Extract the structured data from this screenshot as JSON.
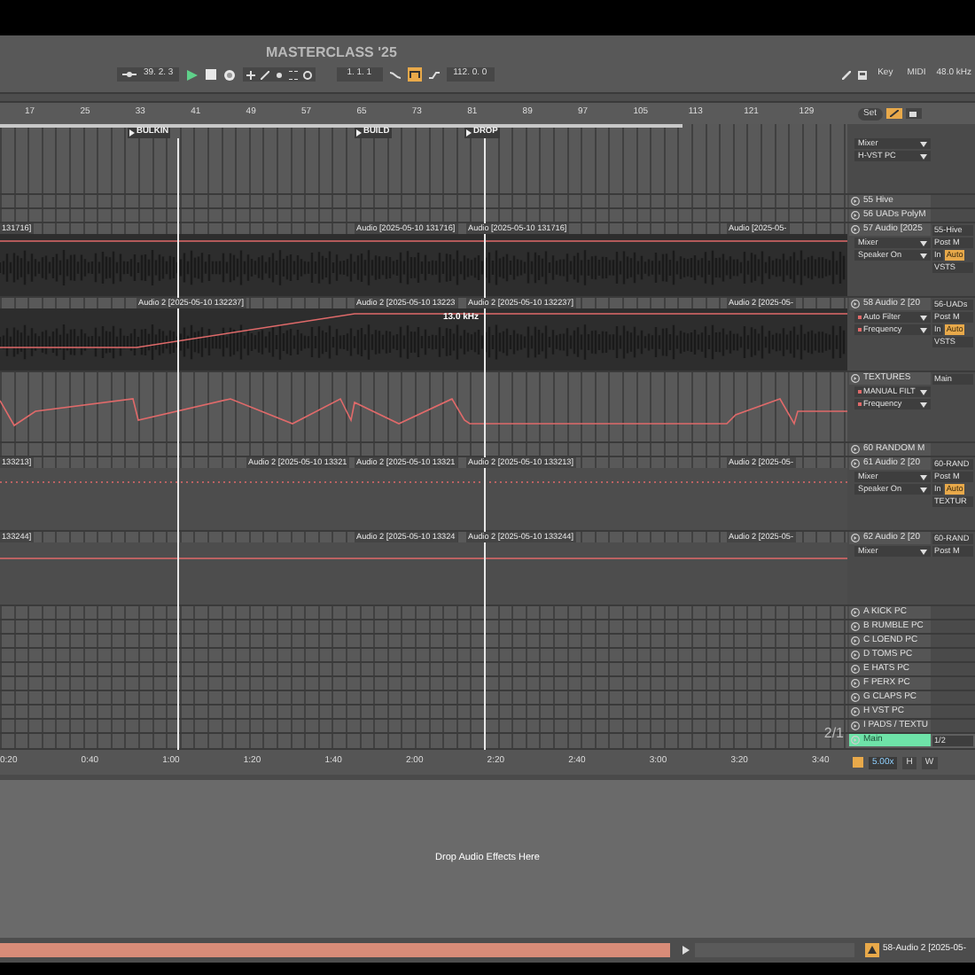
{
  "title": "MASTERCLASS '25",
  "transport": {
    "position": "39. 2. 3",
    "playing": true,
    "loop_start": "1. 1. 1",
    "loop_on": true,
    "loop_length": "112. 0. 0",
    "key_label": "Key",
    "midi_label": "MIDI",
    "sample_rate": "48.0 kHz"
  },
  "bar_ruler": [
    "17",
    "25",
    "33",
    "41",
    "49",
    "57",
    "65",
    "73",
    "81",
    "89",
    "97",
    "105",
    "113",
    "121",
    "129"
  ],
  "locators": [
    "BULKIN",
    "BUILD",
    "DROP"
  ],
  "set_button": "Set",
  "tracks": [
    {
      "kind": "device_rows",
      "devices": [
        {
          "label": "Mixer",
          "automated": false
        },
        {
          "label": "H-VST PC",
          "automated": false
        }
      ]
    },
    {
      "kind": "collapsed",
      "name": "55 Hive"
    },
    {
      "kind": "collapsed",
      "name": "56 UADs PolyM"
    },
    {
      "kind": "audio",
      "name": "57 Audio [2025",
      "devices": [
        {
          "label": "Mixer",
          "automated": false
        },
        {
          "label": "Speaker On",
          "automated": false
        }
      ],
      "io": [
        "55-Hive",
        "Post M"
      ],
      "monitor": [
        {
          "label": "In",
          "selected": false
        },
        {
          "label": "Auto",
          "selected": true
        }
      ],
      "output": "VSTS",
      "lane": {
        "kind": "waveform"
      },
      "clips": [
        "131716]",
        "Audio [2025-05-10 131716]",
        "Audio [2025-05-10 131716]",
        "Audio [2025-05-"
      ]
    },
    {
      "kind": "audio",
      "name": "58 Audio 2 [20",
      "devices": [
        {
          "label": "Auto Filter",
          "automated": true
        },
        {
          "label": "Frequency",
          "automated": true
        }
      ],
      "io": [
        "56-UADs",
        "Post M"
      ],
      "monitor": [
        {
          "label": "In",
          "selected": false
        },
        {
          "label": "Auto",
          "selected": true
        }
      ],
      "output": "VSTS",
      "lane": {
        "kind": "ramp"
      },
      "clips": [
        "Audio 2 [2025-05-10 132237]",
        "Audio 2 [2025-05-10 13223",
        "Audio 2 [2025-05-10 132237]",
        "Audio 2 [2025-05-"
      ],
      "lane_value": "13.0 kHz"
    },
    {
      "kind": "group",
      "name": "TEXTURES",
      "devices": [
        {
          "label": "MANUAL FILT",
          "automated": true
        },
        {
          "label": "Frequency",
          "automated": true
        }
      ],
      "io": [
        "Main"
      ],
      "lane": {
        "kind": "automation"
      }
    },
    {
      "kind": "collapsed",
      "name": "60 RANDOM M"
    },
    {
      "kind": "audio",
      "name": "61 Audio 2 [20",
      "devices": [
        {
          "label": "Mixer",
          "automated": false
        },
        {
          "label": "Speaker On",
          "automated": false
        }
      ],
      "io": [
        "60-RAND",
        "Post M"
      ],
      "monitor": [
        {
          "label": "In",
          "selected": false
        },
        {
          "label": "Auto",
          "selected": true
        }
      ],
      "output": "TEXTUR",
      "lane": {
        "kind": "dotted"
      },
      "clips": [
        "133213]",
        "Audio 2 [2025-05-10 13321",
        "Audio 2 [2025-05-10 13321",
        "Audio 2 [2025-05-10 133213]",
        "Audio 2 [2025-05-"
      ]
    },
    {
      "kind": "audio",
      "name": "62 Audio 2 [20",
      "devices": [
        {
          "label": "Mixer",
          "automated": false
        }
      ],
      "io": [
        "60-RAND",
        "Post M"
      ],
      "lane": {
        "kind": "line"
      },
      "clips": [
        "133244]",
        "Audio 2 [2025-05-10 13324",
        "Audio 2 [2025-05-10 133244]",
        "Audio 2 [2025-05-"
      ]
    },
    {
      "kind": "return",
      "name": "A KICK PC"
    },
    {
      "kind": "return",
      "name": "B RUMBLE PC"
    },
    {
      "kind": "return",
      "name": "C LOEND PC"
    },
    {
      "kind": "return",
      "name": "D TOMS PC"
    },
    {
      "kind": "return",
      "name": "E HATS PC"
    },
    {
      "kind": "return",
      "name": "F PERX PC"
    },
    {
      "kind": "return",
      "name": "G CLAPS PC"
    },
    {
      "kind": "return",
      "name": "H VST PC"
    },
    {
      "kind": "return",
      "name": "I PADS / TEXTU"
    },
    {
      "kind": "main",
      "name": "Main",
      "io": [
        "1/2"
      ],
      "label": "2/1"
    }
  ],
  "time_ruler": [
    "0:20",
    "0:40",
    "1:00",
    "1:20",
    "1:40",
    "2:00",
    "2:20",
    "2:40",
    "3:00",
    "3:20",
    "3:40"
  ],
  "zoom": "5.00x",
  "h_button": "H",
  "w_button": "W",
  "device_area": {
    "hint": "Drop Audio Effects Here"
  },
  "status_bar": {
    "selected_track": "58-Audio 2 [2025-05-"
  }
}
